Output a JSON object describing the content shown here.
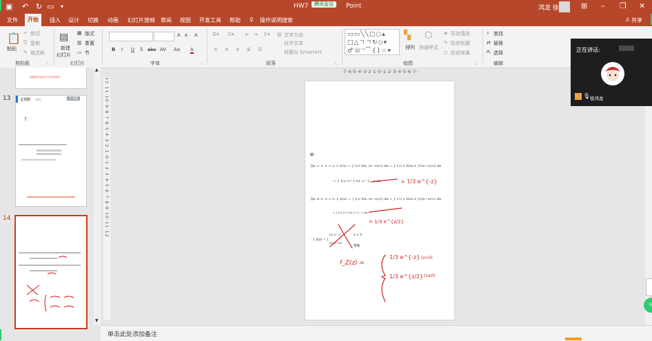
{
  "titlebar": {
    "title_prefix": "HW7",
    "title_suffix": "Point",
    "meeting_badge": "腾讯会议",
    "user_name": "鸿龙 徐"
  },
  "menu": {
    "items": [
      "文件",
      "开始",
      "插入",
      "设计",
      "切换",
      "动画",
      "幻灯片放映",
      "审阅",
      "视图",
      "开发工具",
      "帮助"
    ],
    "tell_me": "操作说明搜索",
    "share": "共享"
  },
  "ribbon": {
    "clipboard": {
      "paste": "粘贴",
      "cut": "剪切",
      "copy": "复制",
      "format_painter": "格式刷",
      "label": "剪贴板"
    },
    "slides": {
      "new_slide": "新建",
      "new_slide2": "幻灯片",
      "layout": "版式",
      "reset": "重置",
      "section": "节",
      "label": "幻灯片"
    },
    "font": {
      "label": "字体",
      "bold": "B",
      "italic": "I",
      "underline": "U",
      "shadow": "S",
      "strike": "abc",
      "grow": "A",
      "shrink": "A",
      "clear": "A",
      "case": "Aa",
      "color": "A",
      "spacing": "AV"
    },
    "paragraph": {
      "label": "段落",
      "text_direction": "文字方向",
      "align_text": "对齐文本",
      "smartart": "转换为 SmartArt"
    },
    "drawing": {
      "label": "绘图",
      "arrange": "排列",
      "quick_styles": "快速样式",
      "fill": "形状填充",
      "outline": "形状轮廓",
      "effects": "形状效果"
    },
    "editing": {
      "label": "编辑",
      "find": "查找",
      "replace": "替换",
      "select": "选择"
    }
  },
  "thumbnails": {
    "slide13_num": "13",
    "slide13_title": "主观题",
    "slide13_badge": "10分",
    "slide13_button": "回 收藏",
    "slide13_q": "?",
    "slide14_num": "14",
    "footer_note": "此题请作答后在5分钟内提交"
  },
  "ruler": {
    "horizontal": "·7·6·5·4·3·2·1·0·1·2·3·4·5·6·7·",
    "vertical": "12·11·10·9·8·7·6·5·4·3·2·1·0·1·2·3·4·5·6·7·8·9·10·11·12"
  },
  "slide": {
    "solution": "解：",
    "line1": "当z > 0, x > z, f_Z(z) = ∫ 1/2 f(x, (x−z)/2) dx = ∫ 1/2 f_X(x) f_Y((x−z)/2) dx",
    "line2": "= ∫ 1/2 e^{-x} e^{...} dx",
    "line2_red": "= 1/3 e^{-z}",
    "line3": "当z ≤ 0, x > 0, f_Z(z) = ∫ 1/2 f(x, (x−z)/2) dx = ∫ 1/2 f_X(x) f_Y((x−z)/2) dx",
    "line4": "= ∫ 1/2 e^{-x} e^{...} dx",
    "line4_red": "= 1/3 e^{z/2}",
    "line5": "∴ f_Z(z) = {",
    "case1": "z > 0,",
    "case2": "其他",
    "red_fz": "f_Z(z) =",
    "red_case1": "1/3 e^{-z}",
    "red_cond1": "(z>0)",
    "red_case2": "1/3 e^{z/2}",
    "red_cond2": "(z≤0)"
  },
  "notes": {
    "placeholder": "单击此处添加备注"
  },
  "meeting": {
    "speaking_label": "正在讲话:",
    "speaker": "徐鸿龙"
  },
  "float_badge": "58"
}
